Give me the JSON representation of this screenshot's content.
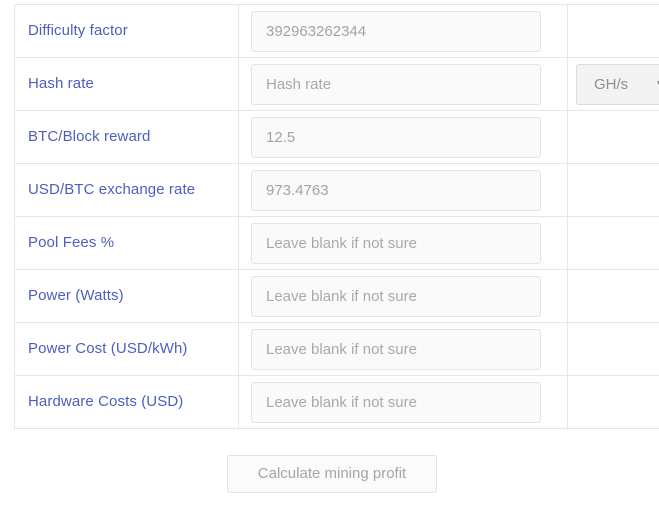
{
  "form": {
    "rows": [
      {
        "label": "Difficulty factor",
        "value": "392963262344",
        "placeholder": "Difficulty factor",
        "has_unit": false
      },
      {
        "label": "Hash rate",
        "value": "",
        "placeholder": "Hash rate",
        "has_unit": true,
        "unit": "GH/s",
        "unit_caret": "▼"
      },
      {
        "label": "BTC/Block reward",
        "value": "12.5",
        "placeholder": "BTC/Block reward",
        "has_unit": false
      },
      {
        "label": "USD/BTC exchange rate",
        "value": "973.4763",
        "placeholder": "USD/BTC exchange rate",
        "has_unit": false
      },
      {
        "label": "Pool Fees %",
        "value": "",
        "placeholder": "Leave blank if not sure",
        "has_unit": false
      },
      {
        "label": "Power (Watts)",
        "value": "",
        "placeholder": "Leave blank if not sure",
        "has_unit": false
      },
      {
        "label": "Power Cost (USD/kWh)",
        "value": "",
        "placeholder": "Leave blank if not sure",
        "has_unit": false
      },
      {
        "label": "Hardware Costs (USD)",
        "value": "",
        "placeholder": "Leave blank if not sure",
        "has_unit": false
      }
    ],
    "submit_label": "Calculate mining profit"
  },
  "colors": {
    "label_text": "#4d5fbe",
    "placeholder_text": "#a9a9a9",
    "border": "#e6e6e6",
    "input_background": "#fafafa",
    "select_background": "#f3f3f3",
    "button_background": "#fbfbfb",
    "page_background": "#ffffff"
  }
}
